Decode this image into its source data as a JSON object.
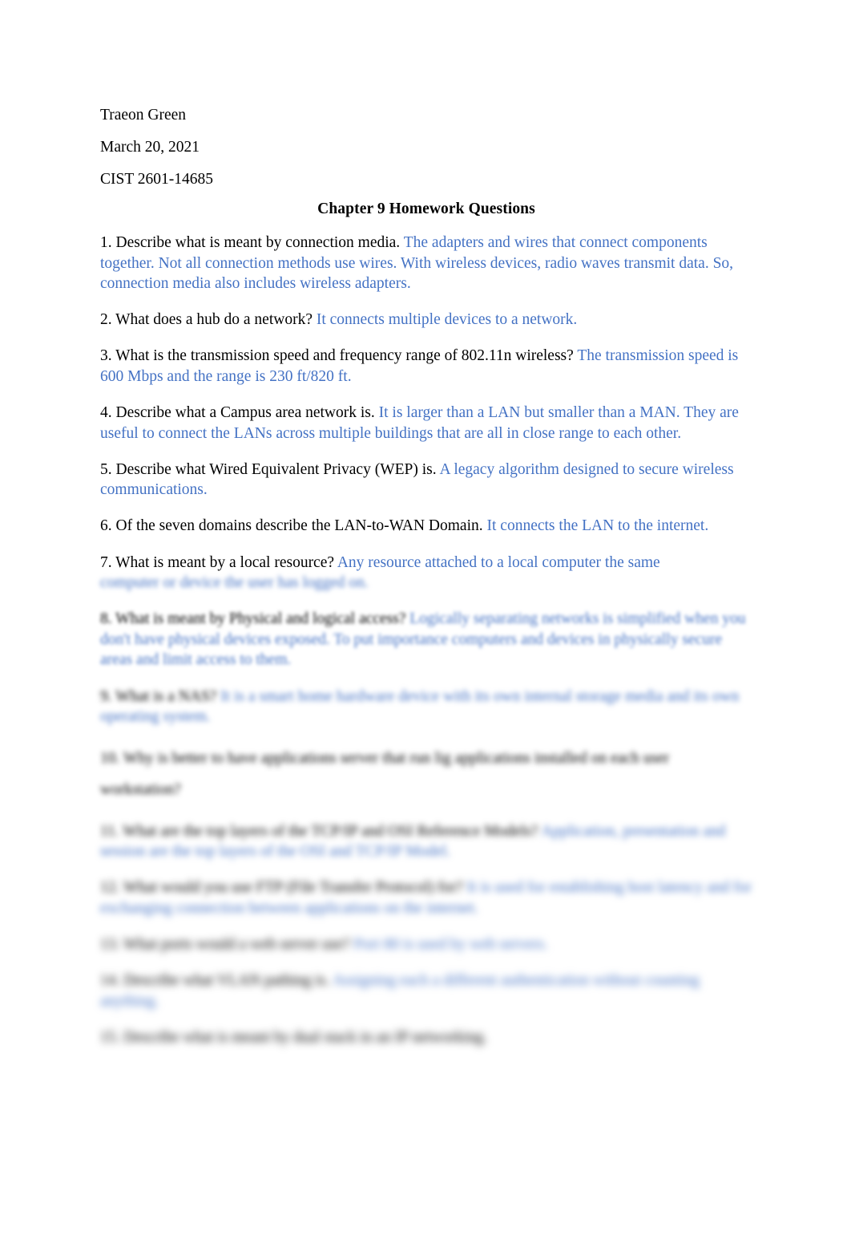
{
  "document": {
    "type": "word-processor-document",
    "page_background": "#ffffff",
    "answer_color": "#4472C4",
    "question_color": "#000000",
    "header": {
      "student_name": "Traeon Green",
      "date": "March 20, 2021",
      "course": "CIST 2601-14685"
    },
    "title": "Chapter 9 Homework Questions",
    "items": [
      {
        "number": "1.",
        "question": "1. Describe what is meant by connection media.",
        "answer": "The adapters and wires that connect components together. Not all connection methods use wires. With wireless devices, radio waves transmit data. So, connection media also includes wireless adapters.",
        "blur_level": 0
      },
      {
        "number": "2.",
        "question": "2. What does a hub do a network?",
        "answer": "It connects multiple devices to a network.",
        "blur_level": 0
      },
      {
        "number": "3.",
        "question": "3. What is the transmission speed and frequency range of 802.11n wireless?",
        "answer": "The transmission speed is 600 Mbps and the range is 230 ft/820 ft.",
        "blur_level": 0
      },
      {
        "number": "4.",
        "question": "4. Describe what a Campus area network is.",
        "answer": "It is larger than a LAN but smaller than a MAN. They are useful to connect the LANs across multiple buildings that are all in close range to each other.",
        "blur_level": 0
      },
      {
        "number": "5.",
        "question": "5. Describe what Wired Equivalent Privacy (WEP) is.",
        "answer": "A legacy algorithm designed to secure wireless communications.",
        "blur_level": 0
      },
      {
        "number": "6.",
        "question": "6. Of the seven domains describe the LAN-to-WAN Domain.",
        "answer": "It connects the LAN to the internet.",
        "blur_level": 0
      },
      {
        "number": "7.",
        "question": "7. What is meant by a local resource?",
        "answer": "Any resource attached to a local computer the same",
        "answer_tail": "computer or device the user has logged on.",
        "blur_level": 1
      },
      {
        "number": "8.",
        "question": "8. What is meant by Physical and logical access?",
        "answer": "Logically separating networks is simplified when you don't have physical devices exposed. To put importance computers and devices in physically secure areas and limit access to them.",
        "blur_level": 3
      },
      {
        "number": "9.",
        "question": "9. What is a NAS?",
        "answer": "It is a smart home hardware device with its own internal storage media and its own operating system.",
        "blur_level": 5
      },
      {
        "number": "10.",
        "question": "10. Why is better to have applications server that run lig applications installed on each user workstation?",
        "answer": "",
        "blur_level": 6,
        "loose_spacing": true
      },
      {
        "number": "11.",
        "question": "11. What are the top layers of the TCP/IP and OSI Reference Models?",
        "answer": "Application, presentation and session are the top layers of the OSI and TCP/IP Model.",
        "blur_level": 7
      },
      {
        "number": "12.",
        "question": "12. What would you use FTP (File Transfer Protocol) for?",
        "answer": "It is used for establishing host latency and for exchanging connection between applications on the internet.",
        "blur_level": 8
      },
      {
        "number": "13.",
        "question": "13. What ports would a web server use?",
        "answer": "Port 80 is used by web servers.",
        "blur_level": 9
      },
      {
        "number": "14.",
        "question": "14. Describe what VLAN pathing is.",
        "answer": "Assigning each a different authentication without counting anything.",
        "blur_level": 9
      },
      {
        "number": "15.",
        "question": "15. Describe what is meant by dual stack in an IP networking.",
        "answer": "",
        "blur_level": 10
      }
    ]
  }
}
